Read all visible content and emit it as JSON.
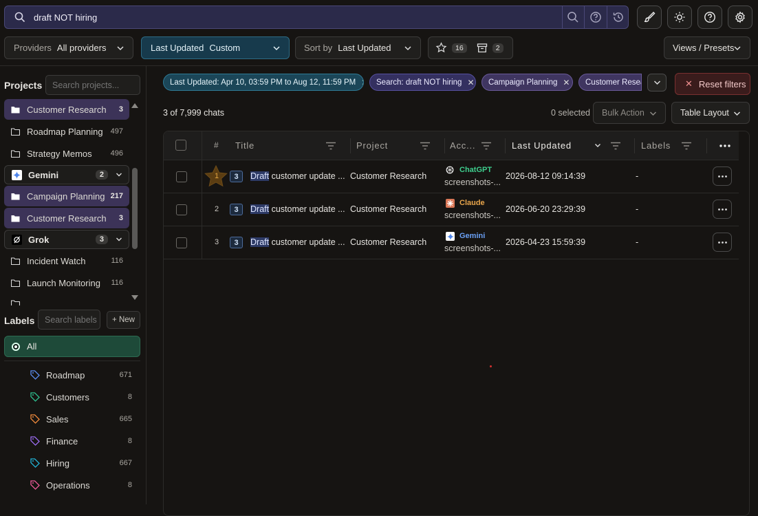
{
  "search": {
    "query": "draft NOT hiring"
  },
  "filters": {
    "providers_label": "Providers",
    "providers_value": "All providers",
    "last_updated_label": "Last Updated",
    "last_updated_value": "Custom",
    "sort_label": "Sort by",
    "sort_value": "Last Updated",
    "starred_count": "16",
    "archived_count": "2",
    "views_label": "Views / Presets"
  },
  "sidebar": {
    "projects_title": "Projects",
    "projects_search_placeholder": "Search projects...",
    "items": [
      {
        "label": "Customer Research",
        "count": "3"
      },
      {
        "label": "Roadmap Planning",
        "count": "497"
      },
      {
        "label": "Strategy Memos",
        "count": "496"
      },
      {
        "label": "Gemini",
        "count": "2"
      },
      {
        "label": "Campaign Planning",
        "count": "217"
      },
      {
        "label": "Customer Research",
        "count": "3"
      },
      {
        "label": "Grok",
        "count": "3"
      },
      {
        "label": "Incident Watch",
        "count": "116"
      },
      {
        "label": "Launch Monitoring",
        "count": "116"
      }
    ],
    "labels_title": "Labels",
    "labels_search_placeholder": "Search labels",
    "new_label": "+ New",
    "all_label": "All",
    "labels": [
      {
        "label": "Roadmap",
        "count": "671",
        "color": "#5b8def"
      },
      {
        "label": "Customers",
        "count": "8",
        "color": "#2fbf8f"
      },
      {
        "label": "Sales",
        "count": "665",
        "color": "#f08a3c"
      },
      {
        "label": "Finance",
        "count": "8",
        "color": "#9b6cf0"
      },
      {
        "label": "Hiring",
        "count": "667",
        "color": "#22b3d6"
      },
      {
        "label": "Operations",
        "count": "8",
        "color": "#ef5a9a"
      }
    ]
  },
  "chips": [
    "Last Updated: Apr 10, 03:59 PM to Aug 12, 11:59 PM",
    "Search: draft NOT hiring",
    "Campaign Planning",
    "Customer Research"
  ],
  "reset_filters": "Reset filters",
  "summary": {
    "count_text": "3 of 7,999 chats",
    "selected_text": "0 selected",
    "bulk_action": "Bulk Action",
    "table_layout": "Table Layout"
  },
  "table": {
    "columns": [
      "#",
      "Title",
      "Project",
      "Acc...",
      "Last Updated",
      "Labels"
    ],
    "rows": [
      {
        "index": "1",
        "badge": "3",
        "title_highlight": "Draft",
        "title_rest": " customer update ...",
        "project": "Customer Research",
        "provider": "ChatGPT",
        "provider_color": "#3ecf8e",
        "account": "screenshots-...",
        "updated": "2026-08-12 09:14:39",
        "labels": "-"
      },
      {
        "index": "2",
        "badge": "3",
        "title_highlight": "Draft",
        "title_rest": " customer update ...",
        "project": "Customer Research",
        "provider": "Claude",
        "provider_color": "#e8a54b",
        "account": "screenshots-...",
        "updated": "2026-06-20 23:29:39",
        "labels": "-"
      },
      {
        "index": "3",
        "badge": "3",
        "title_highlight": "Draft",
        "title_rest": " customer update ...",
        "project": "Customer Research",
        "provider": "Gemini",
        "provider_color": "#6aa0f5",
        "account": "screenshots-...",
        "updated": "2026-04-23 15:59:39",
        "labels": "-"
      }
    ]
  }
}
